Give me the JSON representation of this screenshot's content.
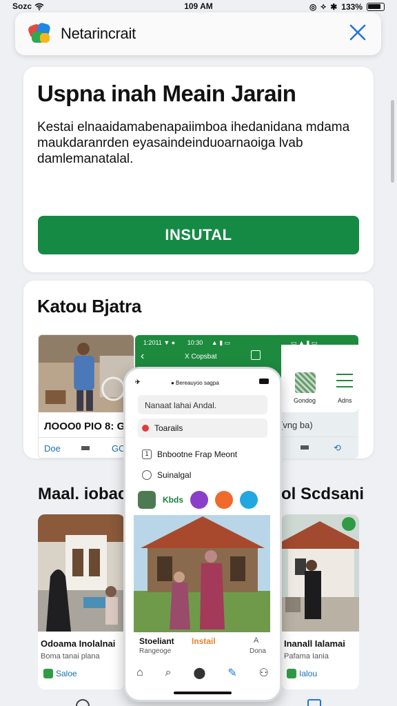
{
  "status_bar": {
    "carrier": "Sozc",
    "time": "109 AM",
    "battery": "133%"
  },
  "app_bar": {
    "title": "Netarincrait",
    "close_icon": "close-icon"
  },
  "install_card": {
    "title": "Uspna inah Meain Jarain",
    "description": "Kestai elnaaidamabenapaiimboa ihedanidana mdama maukdaranrden eyasaindeinduoarnaoiga lvab damlemanatalal.",
    "button_label": "INSUTAL",
    "button_color": "#158a44"
  },
  "feature_card": {
    "title": "Katou Bjatra",
    "mini_left": {
      "price": "ЛООО0 PIO 8:",
      "price_extra": "G",
      "foot_left": "Doe",
      "foot_right": "GC"
    },
    "mini_right": {
      "label": "(vng ba)",
      "foot_icon": "link-icon"
    },
    "green_app": {
      "status_left": "1:2011 ▼ ●",
      "status_center": "10:30",
      "status_right": "▲ ▮ ▭",
      "status_right2": "▭  ▲ ▮ ▭",
      "title": "X Copsbat",
      "right_label1": "Gondog",
      "right_label2": "Adns"
    }
  },
  "phone": {
    "status_left": "✈",
    "status_center": "● Bereauyoo sagpa",
    "search_placeholder": "Nanaat lahai Andal.",
    "rows": [
      {
        "label": "Toarails"
      },
      {
        "label": "Bnbootne Frap Meont"
      },
      {
        "label": "Suinalgal"
      }
    ],
    "box_icon_text": "1",
    "app_label": "Kbds",
    "listing_name": "Stoeliant",
    "listing_action": "Instail",
    "listing_sub": "Rangeoge",
    "listing_flag": "A",
    "listing_done": "Dona",
    "tabbar": [
      "⌂",
      "⌕",
      "⬤",
      "✎",
      "⚇"
    ]
  },
  "shops": {
    "title_left": "Maal. iobac",
    "title_right": "ol Scdsani",
    "left": {
      "name": "Odoama Inolalnai",
      "sub": "Boma tanai plana",
      "tag": "Saloe"
    },
    "right": {
      "name": "Inanall Ialamai",
      "sub": "Pafama Iania",
      "tag": "Ialou"
    }
  }
}
